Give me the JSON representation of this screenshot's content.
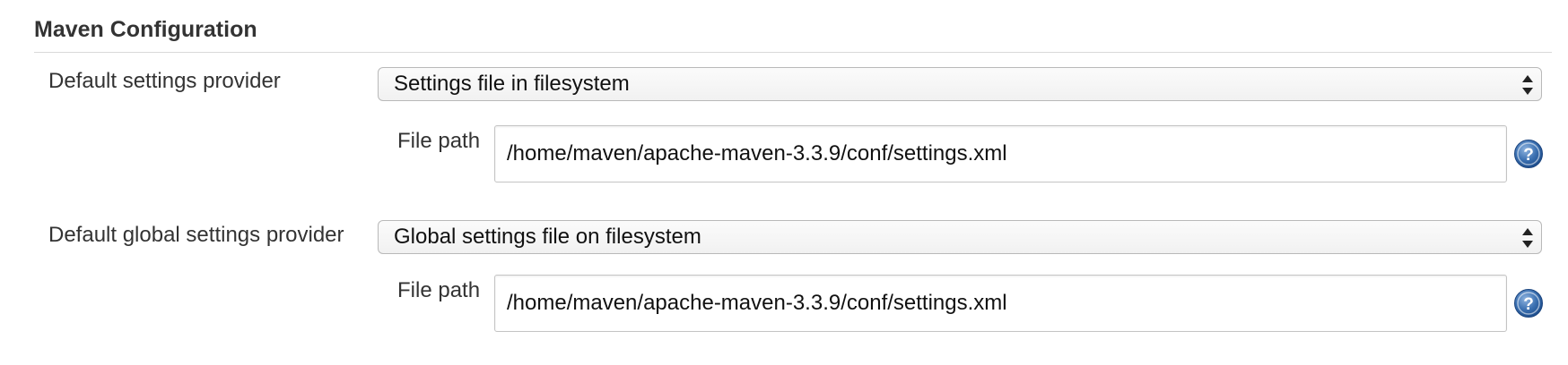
{
  "section": {
    "title": "Maven Configuration"
  },
  "settings_provider": {
    "label": "Default settings provider",
    "selected": "Settings file in filesystem",
    "file_path_label": "File path",
    "file_path_value": "/home/maven/apache-maven-3.3.9/conf/settings.xml"
  },
  "global_settings_provider": {
    "label": "Default global settings provider",
    "selected": "Global settings file on filesystem",
    "file_path_label": "File path",
    "file_path_value": "/home/maven/apache-maven-3.3.9/conf/settings.xml"
  },
  "icons": {
    "help": "help-icon",
    "select_arrows": "chevron-up-down-icon"
  },
  "colors": {
    "help_icon_fill": "#3a6fb0",
    "rule": "#d9d9d9"
  }
}
